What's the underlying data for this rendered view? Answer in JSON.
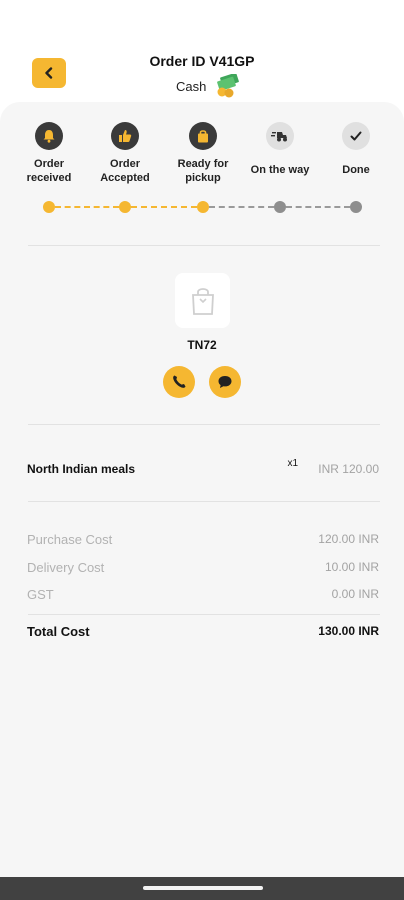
{
  "header": {
    "order_id": "Order ID V41GP",
    "payment_method": "Cash",
    "back_icon": "chevron-left-icon",
    "payment_icon": "cash-icon"
  },
  "steps": [
    {
      "label": "Order\nreceived",
      "icon": "bell-icon",
      "active": true
    },
    {
      "label": "Order\nAccepted",
      "icon": "thumbs-up-icon",
      "active": true
    },
    {
      "label": "Ready for\npickup",
      "icon": "shopping-bag-icon",
      "active": true
    },
    {
      "label": "On the way",
      "icon": "delivery-scooter-icon",
      "active": false
    },
    {
      "label": "Done",
      "icon": "checkmark-icon",
      "active": false
    }
  ],
  "restaurant": {
    "name": "TN72",
    "image_icon": "shopping-bag-placeholder-icon",
    "call_icon": "phone-icon",
    "chat_icon": "chat-bubble-icon"
  },
  "items": [
    {
      "name": "North Indian meals",
      "qty": "x1",
      "price": "INR 120.00"
    }
  ],
  "costs": [
    {
      "label": "Purchase Cost",
      "value": "120.00 INR"
    },
    {
      "label": "Delivery Cost",
      "value": "10.00 INR"
    },
    {
      "label": "GST",
      "value": "0.00 INR"
    }
  ],
  "total": {
    "label": "Total Cost",
    "value": "130.00 INR"
  },
  "colors": {
    "accent": "#f5b731",
    "step_active_bg": "#3a3a3a",
    "step_inactive_bg": "#e0e0e0",
    "sheet_bg": "#f6f6f6",
    "nav_bar": "#414141"
  }
}
